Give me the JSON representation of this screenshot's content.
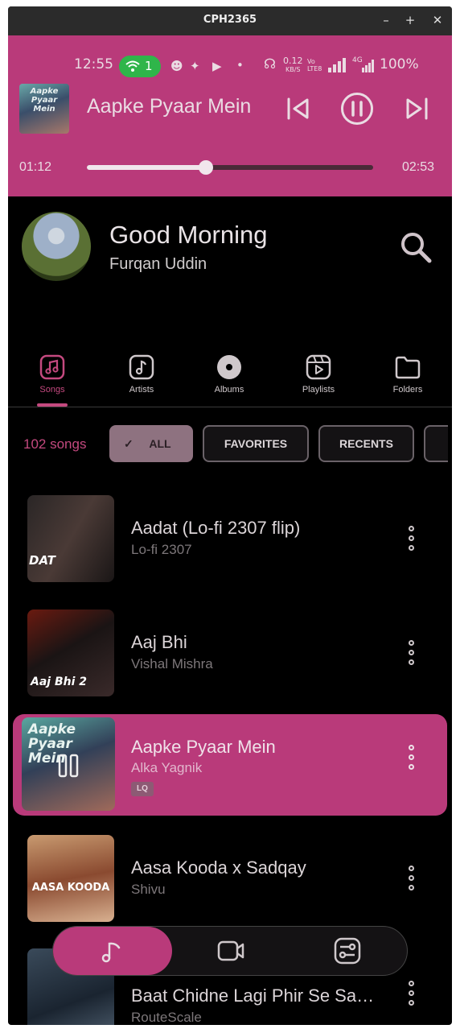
{
  "window": {
    "title": "CPH2365",
    "minimize": "–",
    "maximize": "+",
    "close": "✕"
  },
  "status_bar": {
    "time": "12:55",
    "wifi_count": "1",
    "net_speed_value": "0.12",
    "net_speed_unit": "KB/S",
    "volte": "Vo LTE8",
    "network": "4G",
    "battery": "100%"
  },
  "now_playing": {
    "title": "Aapke Pyaar Mein",
    "elapsed": "01:12",
    "duration": "02:53",
    "progress_fraction": 0.416
  },
  "header": {
    "greeting": "Good Morning",
    "username": "Furqan Uddin"
  },
  "tabs": [
    {
      "label": "Songs",
      "icon": "music-note-icon",
      "active": true
    },
    {
      "label": "Artists",
      "icon": "artist-icon",
      "active": false
    },
    {
      "label": "Albums",
      "icon": "album-disc-icon",
      "active": false
    },
    {
      "label": "Playlists",
      "icon": "playlist-icon",
      "active": false
    },
    {
      "label": "Folders",
      "icon": "folder-icon",
      "active": false
    }
  ],
  "filters": {
    "count_label": "102 songs",
    "chips": [
      {
        "label": "ALL",
        "selected": true
      },
      {
        "label": "FAVORITES",
        "selected": false
      },
      {
        "label": "RECENTS",
        "selected": false
      }
    ]
  },
  "songs": [
    {
      "title": "Aadat (Lo-fi 2307 flip)",
      "artist": "Lo-fi 2307",
      "art_text": "DAT"
    },
    {
      "title": "Aaj Bhi",
      "artist": "Vishal Mishra",
      "art_text": "Aaj Bhi 2"
    },
    {
      "title": "Aapke Pyaar Mein",
      "artist": "Alka Yagnik",
      "badge": "LQ",
      "playing": true,
      "art_text": "Aapke Pyaar Mein"
    },
    {
      "title": "Aasa Kooda x Sadqay",
      "artist": "Shivu",
      "art_text": "AASA KOODA"
    },
    {
      "title": "Baat Chidne Lagi Phir Se Sa…",
      "artist": "RouteScale"
    }
  ],
  "bottom_nav": [
    {
      "icon": "music-note-icon",
      "active": true
    },
    {
      "icon": "video-icon",
      "active": false
    },
    {
      "icon": "settings-sliders-icon",
      "active": false
    }
  ],
  "colors": {
    "accent": "#b93a7a",
    "accent_text": "#c4497f",
    "background": "#000000"
  }
}
